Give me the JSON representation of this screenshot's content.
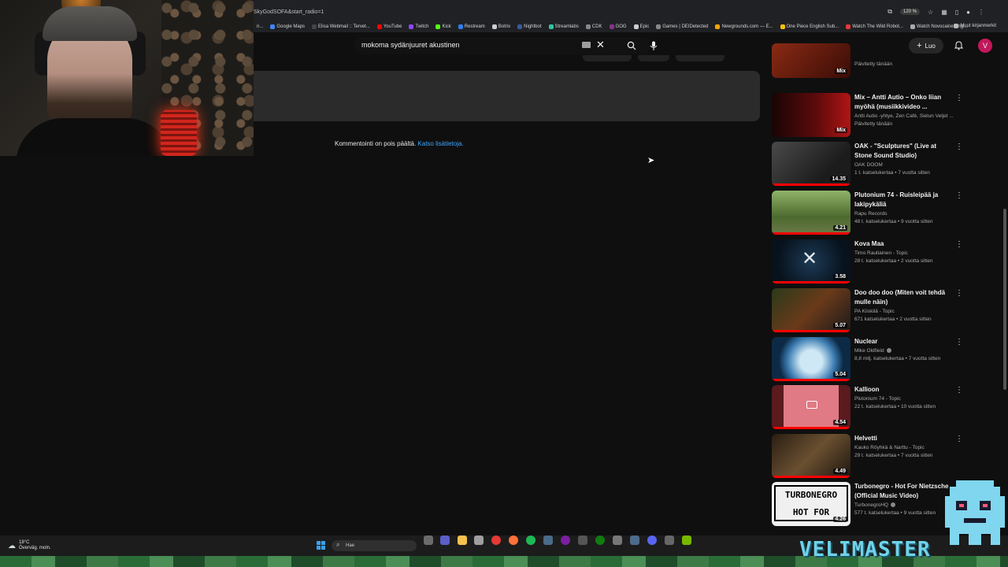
{
  "browser": {
    "url_fragment": "SkyGodSOFA&start_radio=1",
    "zoom": "120 %",
    "bookmarks": [
      {
        "label": "Google Maps",
        "color": "#4285f4"
      },
      {
        "label": "Elisa Webmail :: Tervet...",
        "color": "#444444"
      },
      {
        "label": "YouTube",
        "color": "#ff0000"
      },
      {
        "label": "Twitch",
        "color": "#9146ff"
      },
      {
        "label": "Kick",
        "color": "#53fc18"
      },
      {
        "label": "Restream",
        "color": "#2f80ed"
      },
      {
        "label": "Botrix",
        "color": "#cccccc"
      },
      {
        "label": "Nightbot",
        "color": "#3b5998"
      },
      {
        "label": "Streamlabs",
        "color": "#31c3a2"
      },
      {
        "label": "CDK",
        "color": "#888888"
      },
      {
        "label": "GOG",
        "color": "#86328a"
      },
      {
        "label": "Epic",
        "color": "#cccccc"
      },
      {
        "label": "Games | DEIDetected",
        "color": "#888888"
      },
      {
        "label": "Newgrounds.com — E...",
        "color": "#f7a30a"
      },
      {
        "label": "One Piece English Sub...",
        "color": "#f4c20d"
      },
      {
        "label": "Watch The Wild Robot...",
        "color": "#e53935"
      },
      {
        "label": "Watch Novocaine Engl...",
        "color": "#aaaaaa"
      }
    ],
    "other_bookmarks": "Muut kirjanmerkit"
  },
  "header": {
    "search_query": "mokoma sydänjuuret akustinen",
    "create_label": "Luo",
    "avatar_letter": "V"
  },
  "main": {
    "comments_off_text": "Kommentointi on pois päältä.",
    "learn_more_link": "Katso lisätietoja."
  },
  "sidebar": {
    "items": [
      {
        "title": "",
        "channel": "",
        "meta": "Päivitetty tänään",
        "badge": "Mix",
        "thumb": "#7a1a12"
      },
      {
        "title": "Mix – Antti Autio – Onko liian myöhä (musiikkivideo ...",
        "channel": "Antti Autio -yhtye, Zen Café, Sielun Veljet ...",
        "meta": "Päivitetty tänään",
        "badge": "Mix",
        "thumb": "#5a0a0a"
      },
      {
        "title": "OAK - \"Sculptures\" (Live at Stone Sound Studio)",
        "channel": "OAK DOOM",
        "meta": "1 t. katselukertaa • 7 vuotta sitten",
        "badge": "14.35",
        "thumb": "#3a3a3a"
      },
      {
        "title": "Plutonium 74 - Ruisleipää ja lakipykäliä",
        "channel": "Rapu Records",
        "meta": "48 t. katselukertaa • 9 vuotta sitten",
        "badge": "4.21",
        "thumb": "#4d6a2e"
      },
      {
        "title": "Kova Maa",
        "channel": "Timo Rautiainen - Topic",
        "meta": "28 t. katselukertaa • 2 vuotta sitten",
        "badge": "3.58",
        "thumb": "#0b1c2a"
      },
      {
        "title": "Doo doo doo (Miten voit tehdä mulle näin)",
        "channel": "PA Kiiskilä - Topic",
        "meta": "671 katselukertaa • 2 vuotta sitten",
        "badge": "5.07",
        "thumb": "#4a2a1a"
      },
      {
        "title": "Nuclear",
        "channel": "Mike Oldfield",
        "meta": "8,8 milj. katselukertaa • 7 vuotta sitten",
        "badge": "5.04",
        "thumb": "#1e4f7a"
      },
      {
        "title": "Kallioon",
        "channel": "Plutonium 74 - Topic",
        "meta": "22 t. katselukertaa • 10 vuotta sitten",
        "badge": "4.54",
        "thumb": "#b83a44"
      },
      {
        "title": "Helvetti",
        "channel": "Kauko Röyhkä & Narttu - Topic",
        "meta": "29 t. katselukertaa • 7 vuotta sitten",
        "badge": "4.49",
        "thumb": "#3a2a1e"
      },
      {
        "title": "Turbonegro - Hot For Nietzsche (Official Music Video)",
        "channel": "TurbonegroHQ",
        "meta": "577 t. katselukertaa • 9 vuotta sitten",
        "badge": "4.26",
        "thumb": "#f0f0f0"
      }
    ]
  },
  "taskbar": {
    "temperature": "18°C",
    "weather_desc": "Överväg. moln.",
    "search_placeholder": "Hae"
  },
  "overlay": {
    "brand": "VELIMASTER"
  }
}
